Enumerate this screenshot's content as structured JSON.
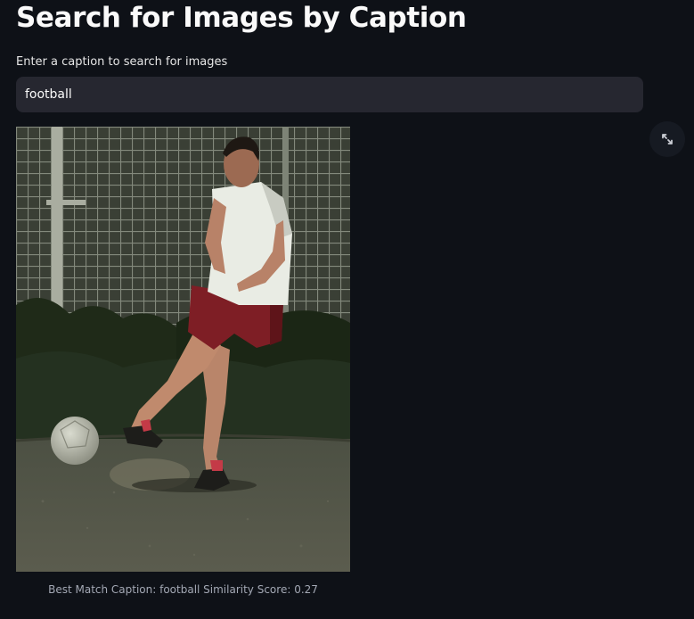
{
  "app": {
    "title": "Search for Images by Caption"
  },
  "search": {
    "label": "Enter a caption to search for images",
    "value": "football"
  },
  "result": {
    "caption": "Best Match Caption: football Similarity Score: 0.27"
  },
  "toolbar": {
    "fullscreen_icon": "expand-icon"
  }
}
